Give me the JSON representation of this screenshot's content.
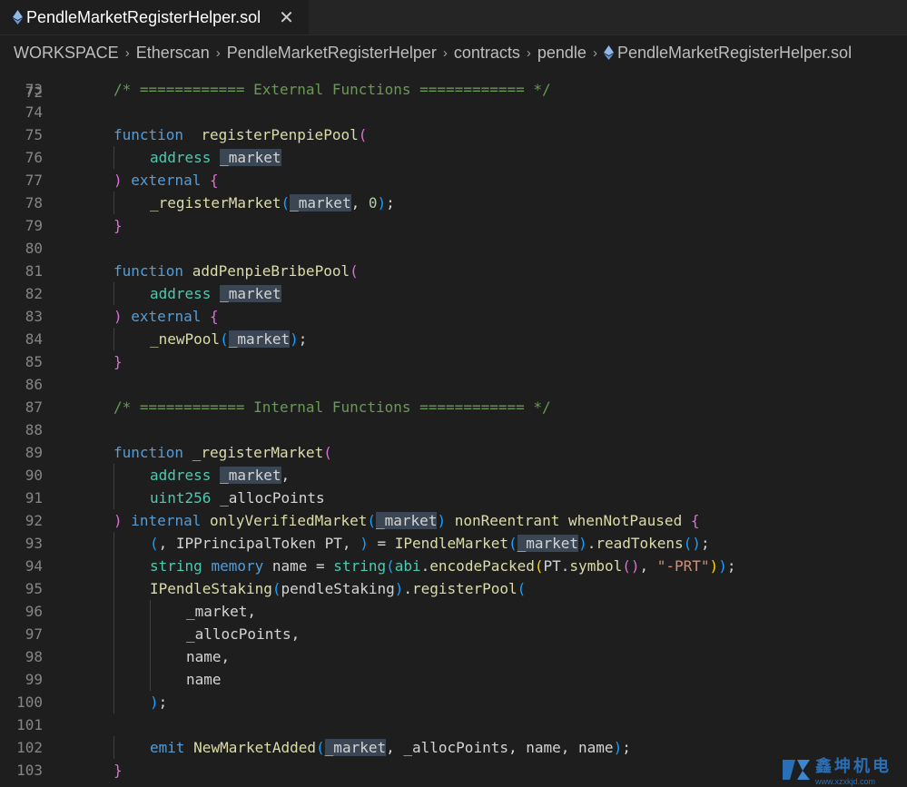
{
  "tab": {
    "filename": "PendleMarketRegisterHelper.sol",
    "close_glyph": "✕"
  },
  "breadcrumb": {
    "items": [
      "WORKSPACE",
      "Etherscan",
      "PendleMarketRegisterHelper",
      "contracts",
      "pendle",
      "PendleMarketRegisterHelper.sol"
    ],
    "separator": "›"
  },
  "editor": {
    "partial_line_number": "72",
    "lines": [
      {
        "n": "73",
        "indent": 1,
        "tokens": [
          [
            "cm",
            "/* ============ External Functions ============ */"
          ]
        ]
      },
      {
        "n": "74",
        "indent": 0,
        "tokens": []
      },
      {
        "n": "75",
        "indent": 1,
        "tokens": [
          [
            "kw",
            "function"
          ],
          [
            "",
            "  "
          ],
          [
            "fn",
            "registerPenpiePool"
          ],
          [
            "p1",
            "("
          ]
        ]
      },
      {
        "n": "76",
        "indent": 2,
        "tokens": [
          [
            "ty",
            "address"
          ],
          [
            "",
            " "
          ],
          [
            "hl",
            "_market"
          ]
        ]
      },
      {
        "n": "77",
        "indent": 1,
        "tokens": [
          [
            "p1",
            ")"
          ],
          [
            "",
            " "
          ],
          [
            "kw",
            "external"
          ],
          [
            "",
            " "
          ],
          [
            "p1",
            "{"
          ]
        ]
      },
      {
        "n": "78",
        "indent": 2,
        "tokens": [
          [
            "fn",
            "_registerMarket"
          ],
          [
            "p2",
            "("
          ],
          [
            "hl",
            "_market"
          ],
          [
            "",
            ", "
          ],
          [
            "nu",
            "0"
          ],
          [
            "p2",
            ")"
          ],
          [
            "",
            ";"
          ]
        ]
      },
      {
        "n": "79",
        "indent": 1,
        "tokens": [
          [
            "p1",
            "}"
          ]
        ]
      },
      {
        "n": "80",
        "indent": 0,
        "tokens": []
      },
      {
        "n": "81",
        "indent": 1,
        "tokens": [
          [
            "kw",
            "function"
          ],
          [
            "",
            " "
          ],
          [
            "fn",
            "addPenpieBribePool"
          ],
          [
            "p1",
            "("
          ]
        ]
      },
      {
        "n": "82",
        "indent": 2,
        "tokens": [
          [
            "ty",
            "address"
          ],
          [
            "",
            " "
          ],
          [
            "hl",
            "_market"
          ]
        ]
      },
      {
        "n": "83",
        "indent": 1,
        "tokens": [
          [
            "p1",
            ")"
          ],
          [
            "",
            " "
          ],
          [
            "kw",
            "external"
          ],
          [
            "",
            " "
          ],
          [
            "p1",
            "{"
          ]
        ]
      },
      {
        "n": "84",
        "indent": 2,
        "tokens": [
          [
            "fn",
            "_newPool"
          ],
          [
            "p2",
            "("
          ],
          [
            "hl",
            "_market"
          ],
          [
            "p2",
            ")"
          ],
          [
            "",
            ";"
          ]
        ]
      },
      {
        "n": "85",
        "indent": 1,
        "tokens": [
          [
            "p1",
            "}"
          ]
        ]
      },
      {
        "n": "86",
        "indent": 0,
        "tokens": []
      },
      {
        "n": "87",
        "indent": 1,
        "tokens": [
          [
            "cm",
            "/* ============ Internal Functions ============ */"
          ]
        ]
      },
      {
        "n": "88",
        "indent": 0,
        "tokens": []
      },
      {
        "n": "89",
        "indent": 1,
        "tokens": [
          [
            "kw",
            "function"
          ],
          [
            "",
            " "
          ],
          [
            "fn",
            "_registerMarket"
          ],
          [
            "p1",
            "("
          ]
        ]
      },
      {
        "n": "90",
        "indent": 2,
        "tokens": [
          [
            "ty",
            "address"
          ],
          [
            "",
            " "
          ],
          [
            "hl",
            "_market"
          ],
          [
            "",
            ","
          ]
        ]
      },
      {
        "n": "91",
        "indent": 2,
        "tokens": [
          [
            "ty",
            "uint256"
          ],
          [
            "",
            " _allocPoints"
          ]
        ]
      },
      {
        "n": "92",
        "indent": 1,
        "tokens": [
          [
            "p1",
            ")"
          ],
          [
            "",
            " "
          ],
          [
            "kw",
            "internal"
          ],
          [
            "",
            " "
          ],
          [
            "fn",
            "onlyVerifiedMarket"
          ],
          [
            "p2",
            "("
          ],
          [
            "hl",
            "_market"
          ],
          [
            "p2",
            ")"
          ],
          [
            "",
            " "
          ],
          [
            "fn",
            "nonReentrant"
          ],
          [
            "",
            " "
          ],
          [
            "fn",
            "whenNotPaused"
          ],
          [
            "",
            " "
          ],
          [
            "p1",
            "{"
          ]
        ]
      },
      {
        "n": "93",
        "indent": 2,
        "tokens": [
          [
            "p2",
            "("
          ],
          [
            "",
            ", IPPrincipalToken PT, "
          ],
          [
            "p2",
            ")"
          ],
          [
            "",
            " = "
          ],
          [
            "fn",
            "IPendleMarket"
          ],
          [
            "p2",
            "("
          ],
          [
            "hl",
            "_market"
          ],
          [
            "p2",
            ")"
          ],
          [
            "",
            "."
          ],
          [
            "fn",
            "readTokens"
          ],
          [
            "p2",
            "()"
          ],
          [
            "",
            ";"
          ]
        ]
      },
      {
        "n": "94",
        "indent": 2,
        "tokens": [
          [
            "ty",
            "string"
          ],
          [
            "",
            " "
          ],
          [
            "kw",
            "memory"
          ],
          [
            "",
            " name = "
          ],
          [
            "ty",
            "string"
          ],
          [
            "p2",
            "("
          ],
          [
            "ty",
            "abi"
          ],
          [
            "",
            "."
          ],
          [
            "fn",
            "encodePacked"
          ],
          [
            "p3",
            "("
          ],
          [
            "",
            "PT."
          ],
          [
            "fn",
            "symbol"
          ],
          [
            "p1",
            "()"
          ],
          [
            "",
            ", "
          ],
          [
            "st",
            "\"-PRT\""
          ],
          [
            "p3",
            ")"
          ],
          [
            "p2",
            ")"
          ],
          [
            "",
            ";"
          ]
        ]
      },
      {
        "n": "95",
        "indent": 2,
        "tokens": [
          [
            "fn",
            "IPendleStaking"
          ],
          [
            "p2",
            "("
          ],
          [
            "",
            "pendleStaking"
          ],
          [
            "p2",
            ")"
          ],
          [
            "",
            "."
          ],
          [
            "fn",
            "registerPool"
          ],
          [
            "p2",
            "("
          ]
        ]
      },
      {
        "n": "96",
        "indent": 3,
        "tokens": [
          [
            "",
            "_market,"
          ]
        ]
      },
      {
        "n": "97",
        "indent": 3,
        "tokens": [
          [
            "",
            "_allocPoints,"
          ]
        ]
      },
      {
        "n": "98",
        "indent": 3,
        "tokens": [
          [
            "",
            "name,"
          ]
        ]
      },
      {
        "n": "99",
        "indent": 3,
        "tokens": [
          [
            "",
            "name"
          ]
        ]
      },
      {
        "n": "100",
        "indent": 2,
        "tokens": [
          [
            "p2",
            ")"
          ],
          [
            "",
            ";"
          ]
        ]
      },
      {
        "n": "101",
        "indent": 0,
        "tokens": []
      },
      {
        "n": "102",
        "indent": 2,
        "tokens": [
          [
            "kw",
            "emit"
          ],
          [
            "",
            " "
          ],
          [
            "fn",
            "NewMarketAdded"
          ],
          [
            "p2",
            "("
          ],
          [
            "hl",
            "_market"
          ],
          [
            "",
            ", _allocPoints, name, name"
          ],
          [
            "p2",
            ")"
          ],
          [
            "",
            ";"
          ]
        ]
      },
      {
        "n": "103",
        "indent": 1,
        "tokens": [
          [
            "p1",
            "}"
          ]
        ]
      }
    ]
  },
  "watermark": {
    "text": "鑫坤机电",
    "url": "www.xzxkjd.com"
  }
}
